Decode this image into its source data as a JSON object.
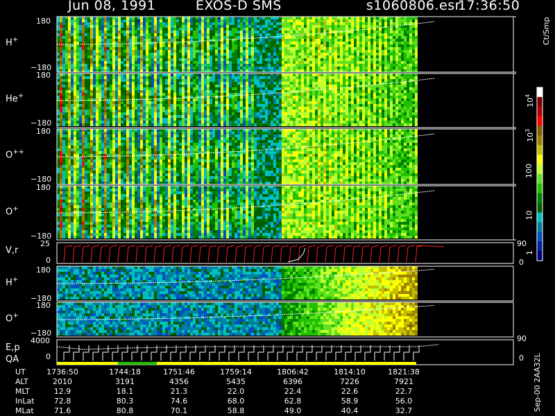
{
  "header": {
    "date": "Jun 08, 1991",
    "instrument": "EXOS-D SMS",
    "file": "s1060806.esr",
    "time": "17:36:50"
  },
  "colorbar": {
    "unit_label": "Ct/Smp",
    "tick_labels": [
      "10^4",
      "10^3",
      "100",
      "10",
      "1"
    ],
    "colors": [
      "#ffffff",
      "#7a0000",
      "#b00000",
      "#ff0000",
      "#806000",
      "#a08000",
      "#c0c000",
      "#ffff00",
      "#c0ff30",
      "#60e020",
      "#20c000",
      "#008000",
      "#006000",
      "#00c0c0",
      "#0080a0",
      "#0050c0",
      "#0020a0",
      "#000080"
    ]
  },
  "chart_data": {
    "type": "heatmap",
    "description_panels": [
      {
        "label_main": "H",
        "label_sup": "+",
        "y_top": "180",
        "y_bottom": "−180"
      },
      {
        "label_main": "He",
        "label_sup": "+",
        "y_top": "180",
        "y_bottom": "−180"
      },
      {
        "label_main": "O",
        "label_sup": "++",
        "y_top": "180",
        "y_bottom": "−180"
      },
      {
        "label_main": "O",
        "label_sup": "+",
        "y_top": "180",
        "y_bottom": "−180"
      }
    ],
    "vr_panel": {
      "label": "V,r",
      "y_top": "25",
      "y_bottom": "0",
      "right_top": "90",
      "right_bottom": "0"
    },
    "lower_panels": [
      {
        "label_main": "H",
        "label_sup": "+",
        "y_top": "180",
        "y_bottom": "−180"
      },
      {
        "label_main": "O",
        "label_sup": "+",
        "y_top": "180",
        "y_bottom": "−180"
      }
    ],
    "ep_panel": {
      "label_top": "E,p",
      "label_bottom": "QA",
      "y_top": "4000",
      "y_bottom": "0",
      "right_top": "90",
      "right_bottom": "0"
    },
    "time_axis": {
      "rows": [
        {
          "name": "UT",
          "values": [
            "1736:50",
            "1744:18",
            "1751:46",
            "1759:14",
            "1806:42",
            "1814:10",
            "1821:38"
          ]
        },
        {
          "name": "ALT",
          "values": [
            "2010",
            "3191",
            "4356",
            "5435",
            "6396",
            "7226",
            "7921"
          ]
        },
        {
          "name": "MLT",
          "values": [
            "12.9",
            "18.1",
            "21.3",
            "22.0",
            "22.4",
            "22.6",
            "22.7"
          ]
        },
        {
          "name": "InLat",
          "values": [
            "72.8",
            "80.3",
            "74.6",
            "68.0",
            "62.8",
            "58.9",
            "56.0"
          ]
        },
        {
          "name": "MLat",
          "values": [
            "71.6",
            "80.8",
            "70.1",
            "58.8",
            "49.0",
            "40.4",
            "32.7"
          ]
        }
      ]
    }
  },
  "side_note": "Sep-00 2AA32L"
}
